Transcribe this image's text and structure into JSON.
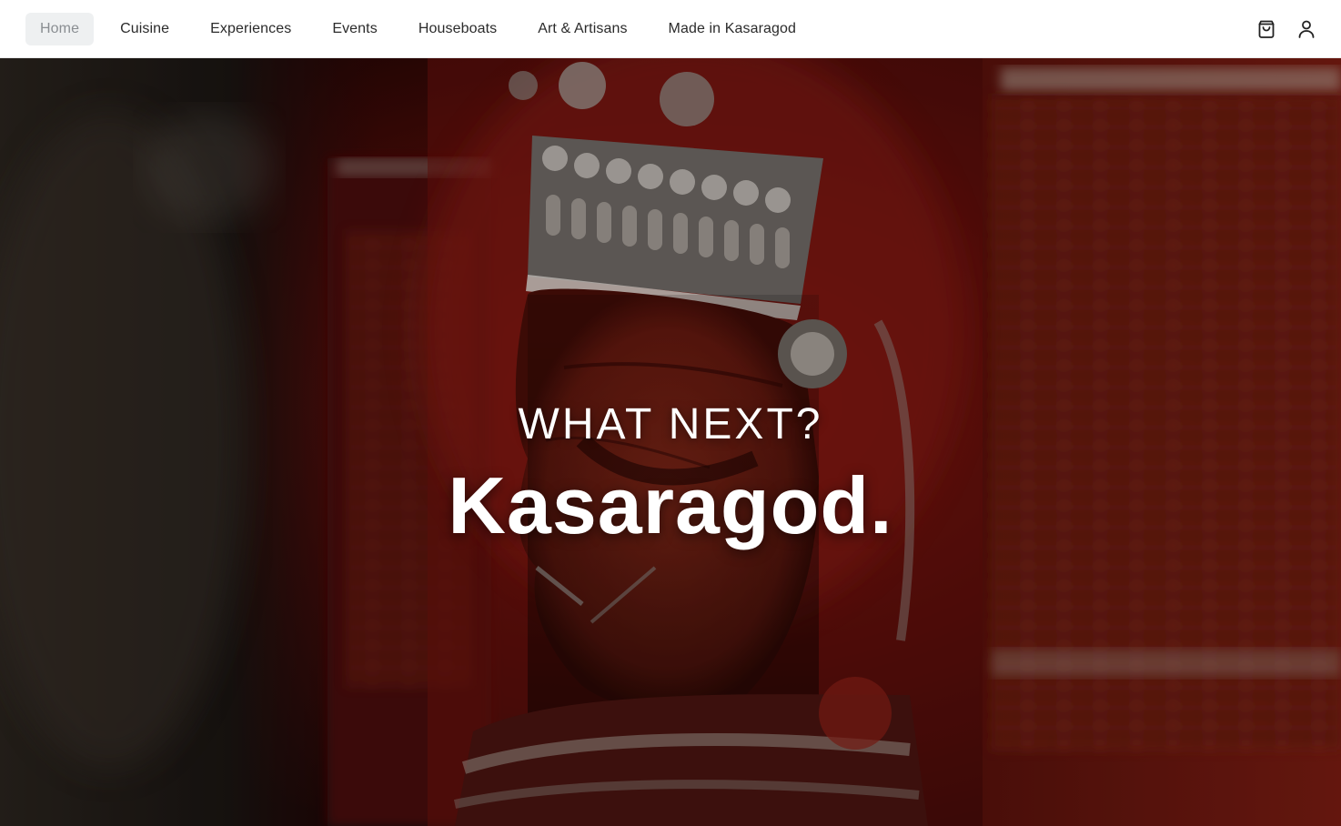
{
  "nav": {
    "items": [
      {
        "label": "Home",
        "active": true
      },
      {
        "label": "Cuisine",
        "active": false
      },
      {
        "label": "Experiences",
        "active": false
      },
      {
        "label": "Events",
        "active": false
      },
      {
        "label": "Houseboats",
        "active": false
      },
      {
        "label": "Art & Artisans",
        "active": false
      },
      {
        "label": "Made in Kasaragod",
        "active": false
      }
    ],
    "icons": [
      "shopping-bag-icon",
      "user-icon"
    ]
  },
  "hero": {
    "eyebrow": "WHAT NEXT?",
    "title": "Kasaragod.",
    "image_subject": "theyyam-performer-photo"
  },
  "colors": {
    "nav_background": "#ffffff",
    "active_pill": "#eef0f1",
    "hero_text": "#ffffff",
    "hero_dominant": "#7a1410"
  }
}
